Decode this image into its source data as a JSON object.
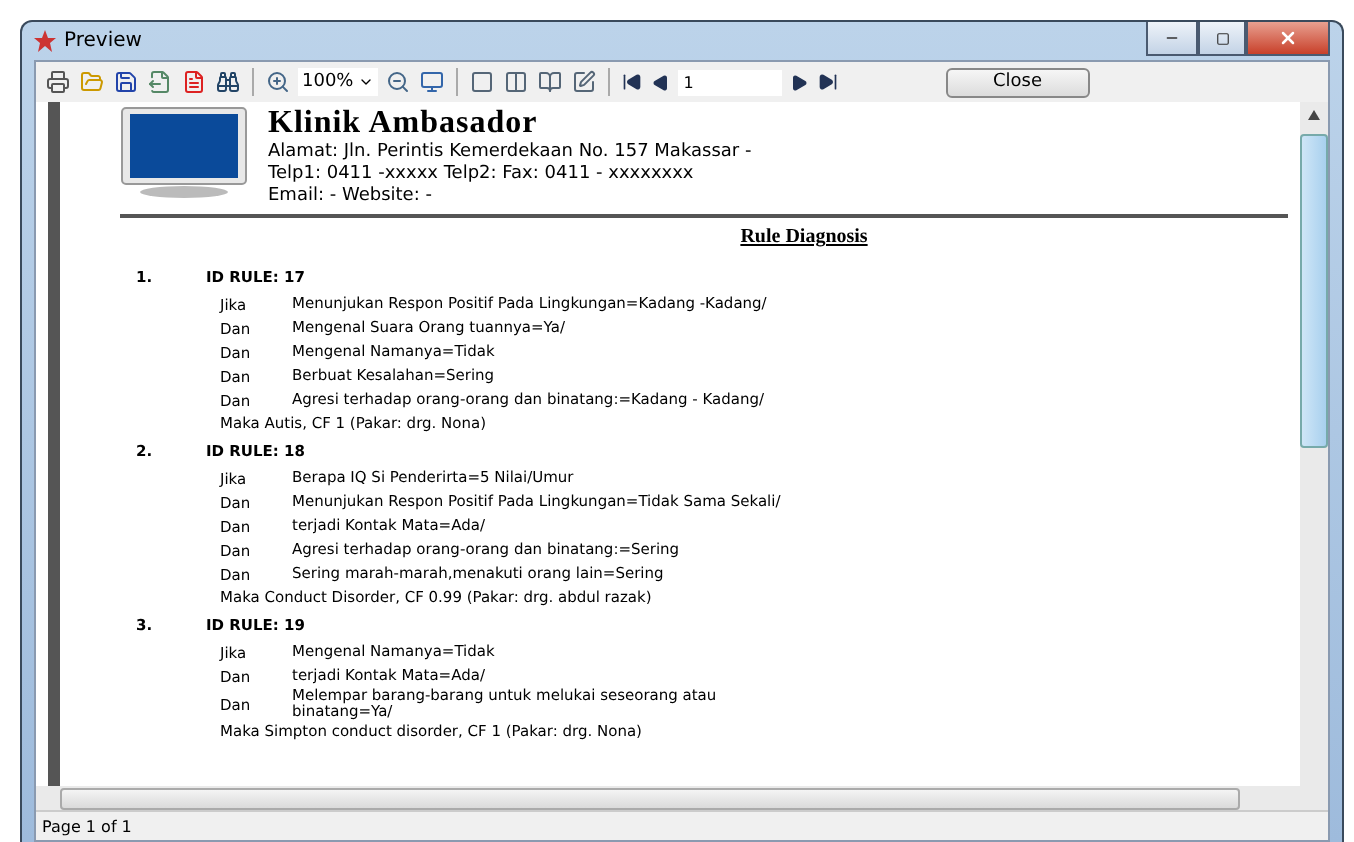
{
  "window": {
    "title": "Preview"
  },
  "toolbar": {
    "zoom": "100%",
    "page": "1",
    "close_button": "Close"
  },
  "report": {
    "clinic_name": "Klinik Ambasador",
    "address_lines": [
      "Alamat: Jln. Perintis Kemerdekaan No. 157 Makassar -",
      "Telp1: 0411 -xxxxx  Telp2:  Fax: 0411 - xxxxxxxx",
      "Email: -  Website: -"
    ],
    "title": "Rule Diagnosis",
    "rules": [
      {
        "number": "1.",
        "id_label": "ID RULE: 17",
        "conditions": [
          {
            "connector": "Jika",
            "text": "Menunjukan Respon Positif Pada Lingkungan=Kadang -Kadang/"
          },
          {
            "connector": "Dan",
            "text": "Mengenal Suara Orang tuannya=Ya/"
          },
          {
            "connector": "Dan",
            "text": "Mengenal Namanya=Tidak"
          },
          {
            "connector": "Dan",
            "text": "Berbuat Kesalahan=Sering"
          },
          {
            "connector": "Dan",
            "text": "Agresi terhadap orang-orang dan binatang:=Kadang - Kadang/"
          }
        ],
        "conclusion": "Maka Autis, CF 1 (Pakar: drg. Nona)"
      },
      {
        "number": "2.",
        "id_label": "ID RULE: 18",
        "conditions": [
          {
            "connector": "Jika",
            "text": "Berapa IQ Si Penderirta=5 Nilai/Umur"
          },
          {
            "connector": "Dan",
            "text": "Menunjukan Respon Positif Pada Lingkungan=Tidak Sama Sekali/"
          },
          {
            "connector": "Dan",
            "text": "terjadi Kontak Mata=Ada/"
          },
          {
            "connector": "Dan",
            "text": "Agresi terhadap orang-orang dan binatang:=Sering"
          },
          {
            "connector": "Dan",
            "text": "Sering marah-marah,menakuti orang lain=Sering"
          }
        ],
        "conclusion": "Maka Conduct Disorder, CF 0.99 (Pakar: drg. abdul razak)"
      },
      {
        "number": "3.",
        "id_label": "ID RULE: 19",
        "conditions": [
          {
            "connector": "Jika",
            "text": "Mengenal Namanya=Tidak"
          },
          {
            "connector": "Dan",
            "text": "terjadi Kontak Mata=Ada/"
          },
          {
            "connector": "Dan",
            "text": "Melempar barang-barang untuk melukai seseorang atau binatang=Ya/"
          }
        ],
        "conclusion": "Maka Simpton conduct disorder, CF 1 (Pakar: drg. Nona)"
      }
    ]
  },
  "status_bar": {
    "page_info": "Page 1 of 1"
  }
}
